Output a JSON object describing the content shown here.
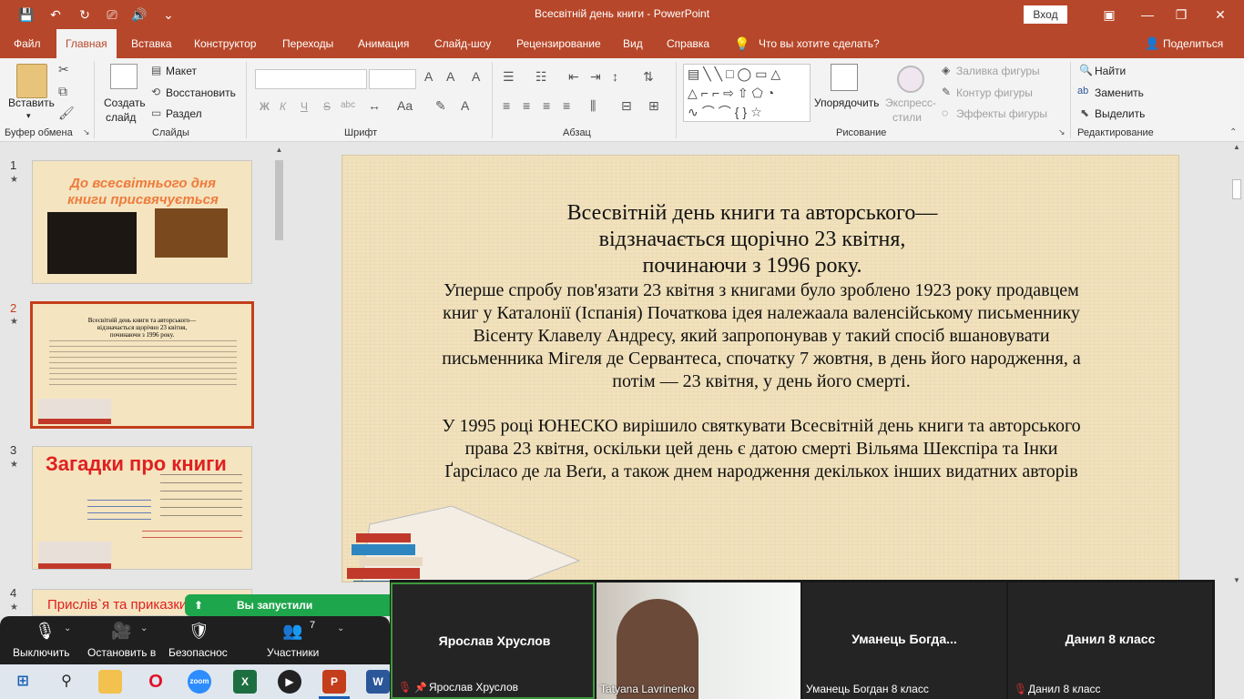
{
  "window": {
    "title": "Всесвітній день книги  -  PowerPoint",
    "login_label": "Вход",
    "controls": {
      "ribbon_display": "▣",
      "minimize": "—",
      "maximize": "❐",
      "close": "✕"
    }
  },
  "quick_access": {
    "save": "💾",
    "undo": "↶",
    "redo": "↻",
    "present": "⎚",
    "sound": "🔊",
    "customize": "⌄"
  },
  "tabs": [
    {
      "label": "Файл"
    },
    {
      "label": "Главная"
    },
    {
      "label": "Вставка"
    },
    {
      "label": "Конструктор"
    },
    {
      "label": "Переходы"
    },
    {
      "label": "Анимация"
    },
    {
      "label": "Слайд-шоу"
    },
    {
      "label": "Рецензирование"
    },
    {
      "label": "Вид"
    },
    {
      "label": "Справка"
    }
  ],
  "tell_me": "Что вы хотите сделать?",
  "share_label": "Поделиться",
  "ribbon": {
    "clipboard": {
      "paste": "Вставить",
      "group": "Буфер обмена"
    },
    "slides": {
      "new_slide_line1": "Создать",
      "new_slide_line2": "слайд",
      "layout": "Макет",
      "reset": "Восстановить",
      "section": "Раздел",
      "group": "Слайды"
    },
    "font": {
      "group": "Шрифт",
      "bold": "Ж",
      "italic": "К",
      "underline": "Ч",
      "strike": "S",
      "shadow": "abc"
    },
    "paragraph": {
      "group": "Абзац"
    },
    "drawing": {
      "arrange": "Упорядочить",
      "styles_line1": "Экспресс-",
      "styles_line2": "стили",
      "fill": "Заливка фигуры",
      "outline": "Контур фигуры",
      "effects": "Эффекты фигуры",
      "group": "Рисование"
    },
    "editing": {
      "find": "Найти",
      "replace": "Заменить",
      "select": "Выделить",
      "group": "Редактирование"
    }
  },
  "thumbnails": [
    {
      "num": "1",
      "title_line1": "До всесвітнього дня",
      "title_line2": "книги присвячується"
    },
    {
      "num": "2",
      "line1": "Всесвітній день книги та авторського—",
      "line2": "відзначається щорічно 23 квітня,",
      "line3": "починаючи з 1996 року."
    },
    {
      "num": "3",
      "title": "Загадки про книги"
    },
    {
      "num": "4",
      "title": "Прислів`я та приказки п"
    }
  ],
  "slide": {
    "title_line1": "Всесвітній день книги та авторського—",
    "title_line2": "відзначається щорічно 23 квітня,",
    "title_line3": "починаючи з 1996 року.",
    "para1_line1": "Уперше спробу пов'язати 23 квітня з книгами було зроблено 1923 року продавцем",
    "para1_line2": "книг у Каталонії (Іспанія) Початкова ідея належаала валенсійському письменнику",
    "para1_line3": "Вісенту Клавелу Андресу, який запропонував у такий спосіб вшановувати",
    "para1_line4": "письменника Мігеля де Сервантеса, спочатку 7 жовтня, в день його народження, а",
    "para1_line5": "потім — 23 квітня, у день його смерті.",
    "para2_line1": "У 1995 році ЮНЕСКО вирішило святкувати Всесвітній день книги та авторського",
    "para2_line2": "права 23 квітня, оскільки цей  день є датою смерті Вільяма Шекспіра та Інки",
    "para2_line3": "Ґарсіласо де ла Веґи, а також днем народження декількох інших видатних авторів"
  },
  "zoom": {
    "toast": "Вы запустили демонстрацию",
    "mute": "Выключить",
    "stop_video": "Остановить в",
    "security": "Безопаснос",
    "participants": "Участники",
    "participants_count": "7",
    "tiles": [
      {
        "name": "Ярослав Хруслов",
        "sub": "Ярослав Хруслов"
      },
      {
        "name": "",
        "sub": "Tatyana Lavrinenko"
      },
      {
        "name": "Уманець  Богда...",
        "sub": "Уманець Богдан 8 класс"
      },
      {
        "name": "Данил 8 класс",
        "sub": "Данил 8 класс"
      }
    ]
  },
  "taskbar": {
    "word_label": "W",
    "excel_label": "X",
    "ppt_label": "P",
    "zoom_label": "zoom"
  }
}
